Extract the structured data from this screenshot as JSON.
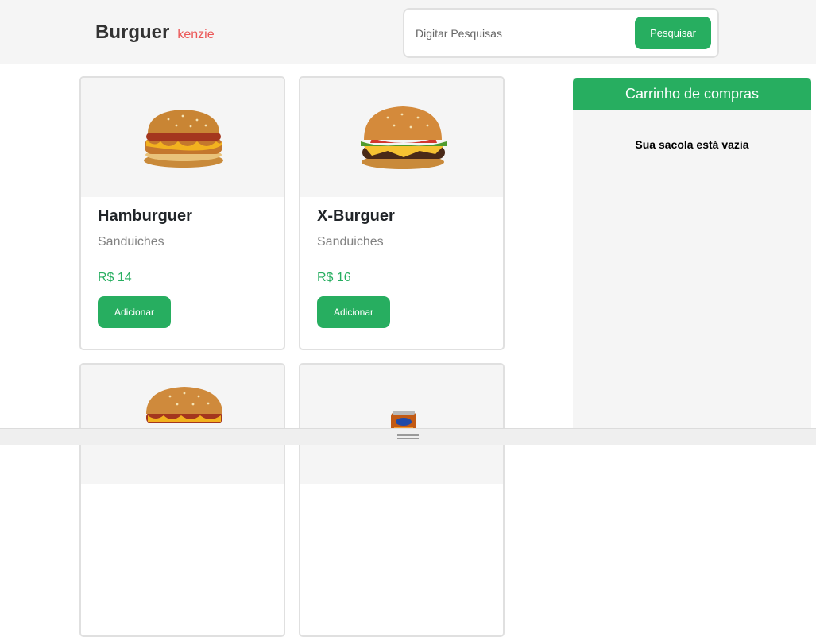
{
  "header": {
    "logo_main": "Burguer",
    "logo_sub": "kenzie",
    "search": {
      "placeholder": "Digitar Pesquisas",
      "button_label": "Pesquisar"
    }
  },
  "products": [
    {
      "name": "Hamburguer",
      "category": "Sanduiches",
      "price": "R$ 14",
      "button_label": "Adicionar",
      "image": "hamburger-icon"
    },
    {
      "name": "X-Burguer",
      "category": "Sanduiches",
      "price": "R$ 16",
      "button_label": "Adicionar",
      "image": "cheeseburger-icon"
    },
    {
      "name": "",
      "category": "",
      "price": "",
      "button_label": "",
      "image": "burger-icon"
    },
    {
      "name": "",
      "category": "",
      "price": "",
      "button_label": "",
      "image": "soda-can-icon"
    }
  ],
  "cart": {
    "title": "Carrinho de compras",
    "empty_message": "Sua sacola está vazia"
  },
  "colors": {
    "accent": "#27ae60",
    "brand_secondary": "#eb5757",
    "panel_bg": "#f5f5f5"
  }
}
